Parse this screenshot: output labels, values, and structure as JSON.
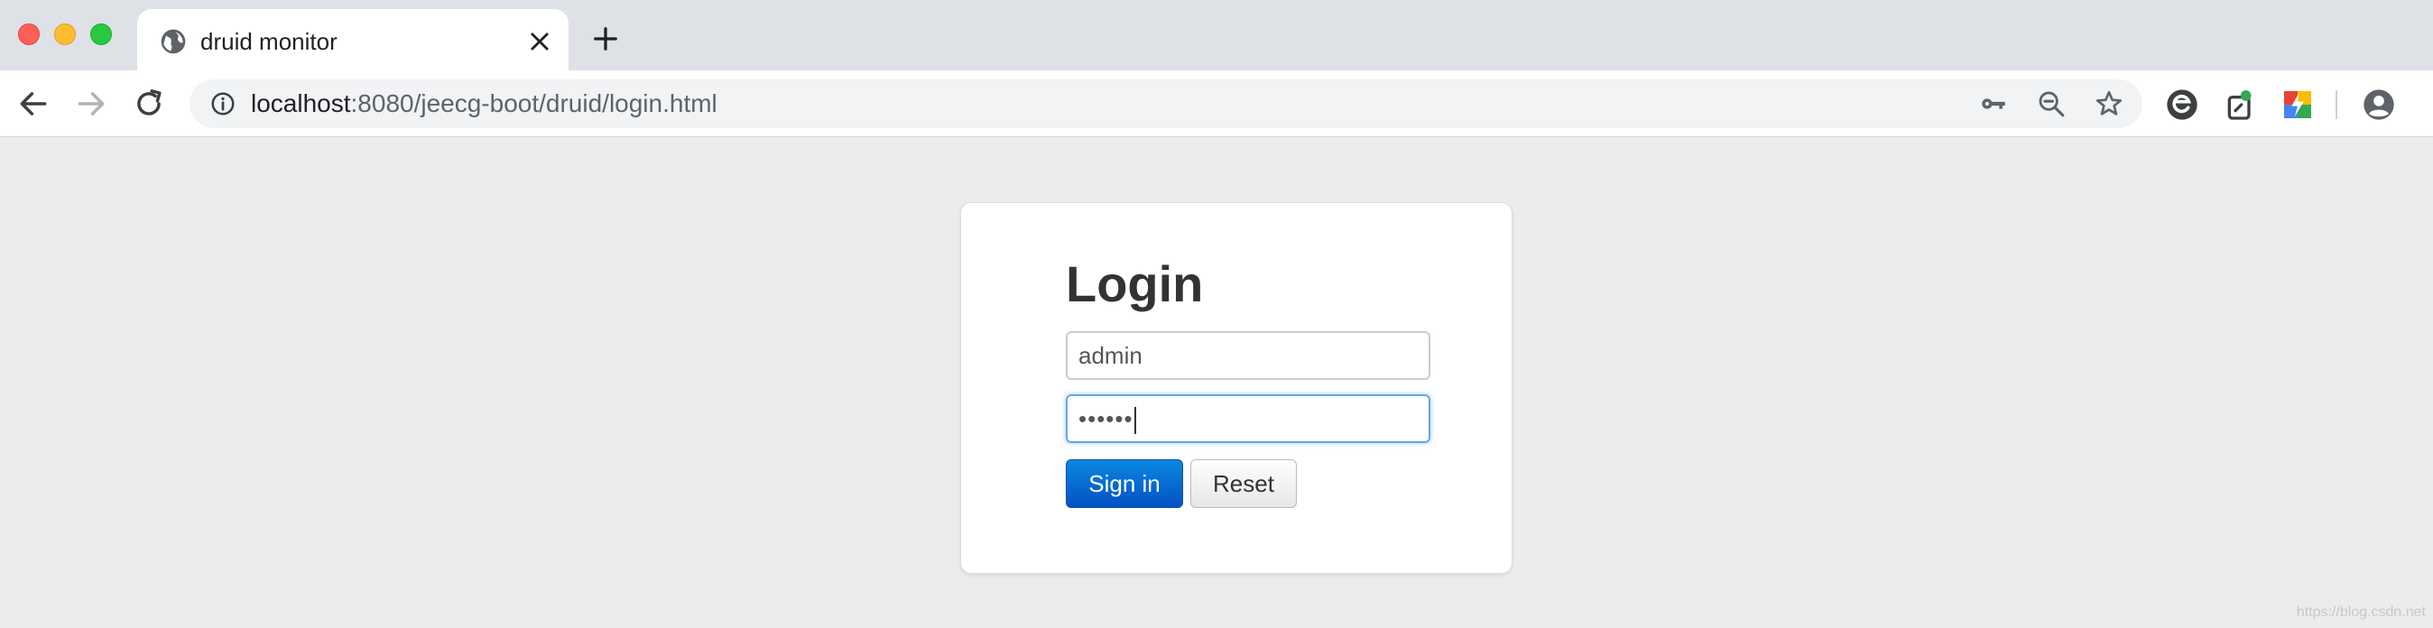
{
  "browser": {
    "tab": {
      "title": "druid monitor"
    },
    "address": {
      "host": "localhost",
      "path": ":8080/jeecg-boot/druid/login.html"
    }
  },
  "login": {
    "title": "Login",
    "username_value": "admin",
    "password_mask": "••••••",
    "signin_label": "Sign in",
    "reset_label": "Reset"
  },
  "watermark": "https://blog.csdn.net",
  "colors": {
    "primary_button": "#0a6fd8",
    "page_background": "#ececec",
    "tabstrip": "#dee1e6"
  }
}
